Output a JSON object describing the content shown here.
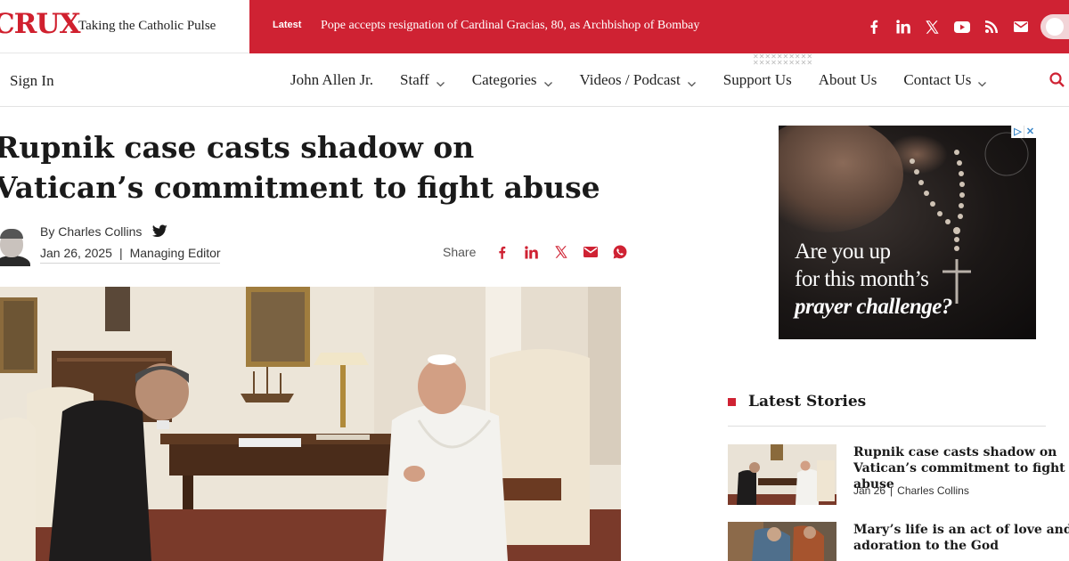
{
  "brand": {
    "logo": "CRUX",
    "tagline": "Taking the Catholic Pulse"
  },
  "ticker": {
    "label": "Latest",
    "headline": "Pope accepts resignation of Cardinal Gracias, 80, as Archbishop of Bombay"
  },
  "social_icons": [
    "facebook-icon",
    "linkedin-icon",
    "x-icon",
    "youtube-icon",
    "rss-icon",
    "email-icon"
  ],
  "nav": {
    "sign_in": "Sign In",
    "items": [
      {
        "label": "John Allen Jr.",
        "dropdown": false
      },
      {
        "label": "Staff",
        "dropdown": true
      },
      {
        "label": "Categories",
        "dropdown": true
      },
      {
        "label": "Videos / Podcast",
        "dropdown": true
      },
      {
        "label": "Support Us",
        "dropdown": false
      },
      {
        "label": "About Us",
        "dropdown": false
      },
      {
        "label": "Contact Us",
        "dropdown": true
      }
    ]
  },
  "article": {
    "title": "Rupnik case casts shadow on Vatican’s commitment to fight abuse",
    "byline": "By Charles Collins",
    "date": "Jan 26, 2025",
    "separator": "|",
    "role": "Managing Editor",
    "share_label": "Share"
  },
  "ad": {
    "line1": "Are you up",
    "line2": "for this month’s",
    "line3": "prayer challenge?"
  },
  "sidebar": {
    "latest_title": "Latest Stories",
    "stories": [
      {
        "title": "Rupnik case casts shadow on Vatican’s commitment to fight abuse",
        "date": "Jan 26",
        "author": "Charles Collins"
      },
      {
        "title": "Mary’s life is an act of love and adoration to the God",
        "date": "",
        "author": ""
      }
    ]
  },
  "colors": {
    "brand_red": "#cf2233",
    "text": "#1a1a1a"
  }
}
